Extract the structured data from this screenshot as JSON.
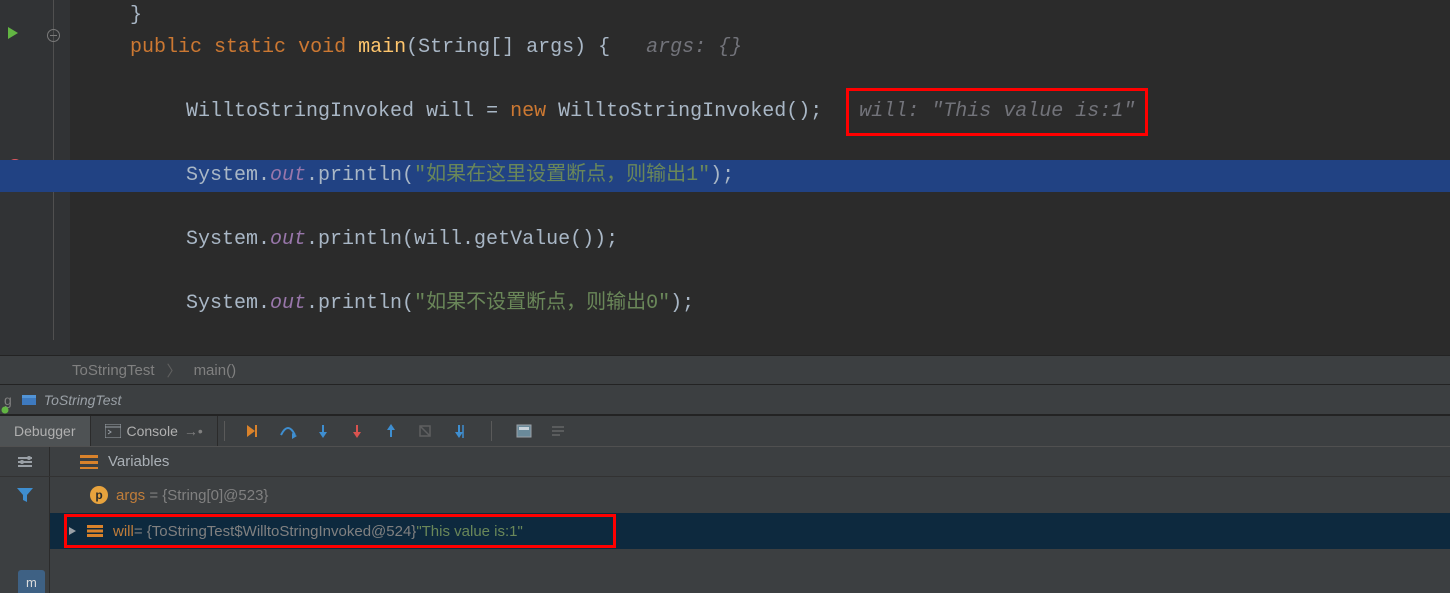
{
  "code": {
    "line0_close": "}",
    "line1": {
      "k1": "public",
      "k2": "static",
      "k3": "void",
      "method": "main",
      "params": "(String[] args) {",
      "hint": "args: {}"
    },
    "line2": {
      "type": "WilltoStringInvoked",
      "var": "will",
      "eq": "=",
      "knew": "new",
      "ctor": "WilltoStringInvoked();",
      "hint_key": "will:",
      "hint_val": "\"This value is:1\""
    },
    "line3": {
      "sys": "System.",
      "out": "out",
      "pr": ".println(",
      "str": "\"如果在这里设置断点，则输出1\"",
      "end": ");"
    },
    "line4": {
      "sys": "System.",
      "out": "out",
      "pr": ".println(will.getValue());"
    },
    "line5": {
      "sys": "System.",
      "out": "out",
      "pr": ".println(",
      "str": "\"如果不设置断点，则输出0\"",
      "end": ");"
    }
  },
  "breadcrumb": {
    "a": "ToStringTest",
    "b": "main()"
  },
  "debug": {
    "title_prefix": "g",
    "title": "ToStringTest",
    "tab_debugger": "Debugger",
    "tab_console": "Console",
    "vars_title": "Variables",
    "args": {
      "badge": "p",
      "name": "args",
      "rest": " = {String[0]@523}"
    },
    "will": {
      "name": "will",
      "type": " = {ToStringTest$WilltoStringInvoked@524} ",
      "str": "\"This value is:1\""
    }
  },
  "bottom_tab": "m"
}
